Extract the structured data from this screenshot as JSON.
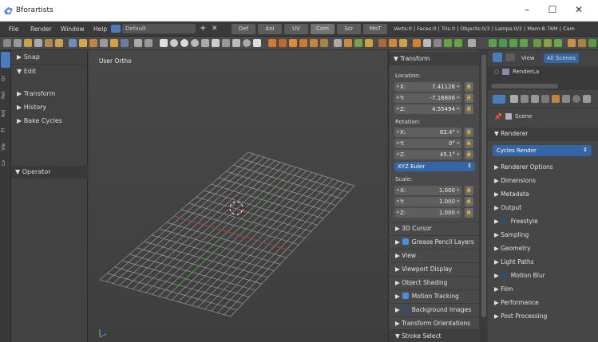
{
  "window": {
    "title": "Bforartists",
    "minimize": "–",
    "maximize": "☐",
    "close": "✕"
  },
  "menubar": {
    "menus": [
      "File",
      "Render",
      "Window",
      "Help"
    ],
    "layout": "Default",
    "add": "+",
    "remove": "✕",
    "workspaces": [
      "Def",
      "Ani",
      "UV",
      "Com",
      "Scr",
      "MoT"
    ],
    "stats": "Verts:0 | Faces:0 | Tris:0 | Objects:0/3 | Lamps:0/2 | Mem:8.76M | Cam"
  },
  "tabs": [
    "Lo",
    "Gr",
    "Pl",
    "Rel",
    "Ani",
    "Vie"
  ],
  "shelf": {
    "items": [
      {
        "label": "▶ Snap"
      },
      {
        "label": "▼ Edit"
      },
      {
        "label": "▶ Transform"
      },
      {
        "label": "▶ History"
      },
      {
        "label": "▶ Bake Cycles"
      }
    ],
    "operator": "▼ Operator"
  },
  "viewport": {
    "label": "User Ortho"
  },
  "transform": {
    "header": "▼ Transform",
    "location_label": "Location:",
    "location": [
      {
        "axis": "X:",
        "value": "7.41128"
      },
      {
        "axis": "Y:",
        "value": "-7.16806"
      },
      {
        "axis": "Z:",
        "value": "4.55494"
      }
    ],
    "rotation_label": "Rotation:",
    "rotation": [
      {
        "axis": "X:",
        "value": "62.4°"
      },
      {
        "axis": "Y:",
        "value": "0°"
      },
      {
        "axis": "Z:",
        "value": "45.1°"
      }
    ],
    "rotation_mode": "XYZ Euler",
    "scale_label": "Scale:",
    "scale": [
      {
        "axis": "X:",
        "value": "1.000"
      },
      {
        "axis": "Y:",
        "value": "1.000"
      },
      {
        "axis": "Z:",
        "value": "1.000"
      }
    ]
  },
  "npanel_sections": [
    {
      "label": "▶ 3D Cursor"
    },
    {
      "label": "Grease Pencil Layers",
      "prefix": "▶",
      "checkbox": "checked"
    },
    {
      "label": "▶ View"
    },
    {
      "label": "▶ Viewport Display"
    },
    {
      "label": "▶ Object Shading"
    },
    {
      "label": "Motion Tracking",
      "prefix": "▶",
      "checkbox": "checked"
    },
    {
      "label": "Background Images",
      "prefix": "▶",
      "checkbox": "unchecked"
    },
    {
      "label": "▶ Transform Orientations"
    },
    {
      "label": "▼ Stroke Select"
    }
  ],
  "outliner": {
    "tabs": [
      "View",
      "All Scenes"
    ],
    "item": "RenderLa"
  },
  "properties": {
    "scene": "Scene",
    "renderer_header": "▼ Renderer",
    "engine": "Cycles Render",
    "engine_arrow": "⇕",
    "panels": [
      {
        "label": "▶ Renderer Options"
      },
      {
        "label": "▶ Dimensions"
      },
      {
        "label": "▶ Metadata"
      },
      {
        "label": "▶ Output"
      },
      {
        "label": "Freestyle",
        "prefix": "▶",
        "checkbox": "unchecked"
      },
      {
        "label": "▶ Sampling"
      },
      {
        "label": "▶ Geometry"
      },
      {
        "label": "▶ Light Paths"
      },
      {
        "label": "Motion Blur",
        "prefix": "▶",
        "checkbox": "unchecked"
      },
      {
        "label": "▶ Film"
      },
      {
        "label": "▶ Performance"
      },
      {
        "label": "▶ Post Processing"
      }
    ]
  },
  "colors": {
    "accent": "#3465a4",
    "checkbox": "#4a8fd8",
    "grid_line": "#9a9a9a",
    "x_axis": "#a04040",
    "y_axis": "#5a9a50"
  }
}
